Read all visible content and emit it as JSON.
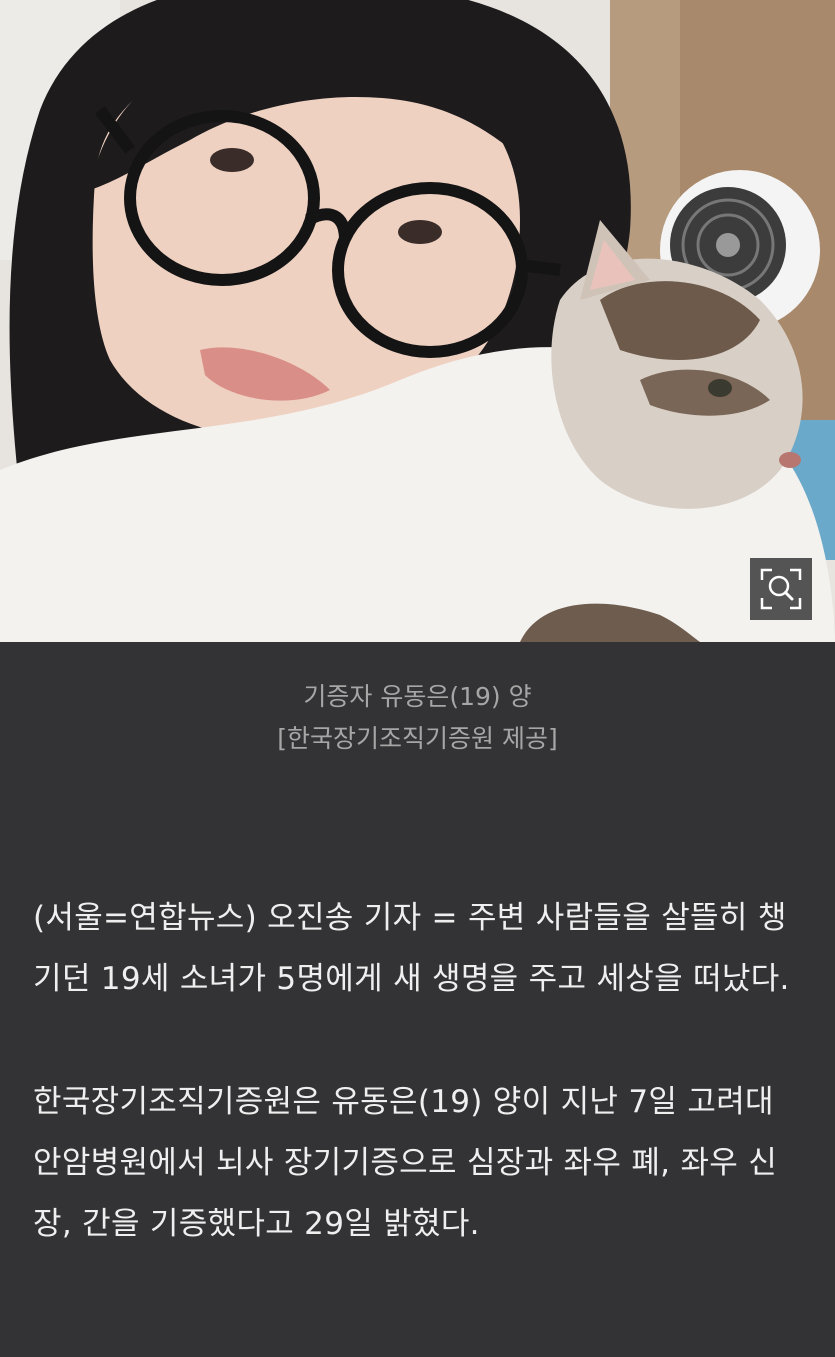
{
  "photo": {
    "zoom_icon": "magnifier-zoom-icon"
  },
  "caption": {
    "line1": "기증자 유동은(19) 양",
    "line2": "[한국장기조직기증원 제공]"
  },
  "article": {
    "p1": "(서울=연합뉴스) 오진송 기자 = 주변 사람들을 살뜰히 챙기던 19세 소녀가 5명에게 새 생명을 주고 세상을 떠났다.",
    "p2": "한국장기조직기증원은 유동은(19) 양이 지난 7일 고려대 안암병원에서 뇌사 장기기증으로 심장과 좌우 폐, 좌우 신장, 간을 기증했다고 29일 밝혔다."
  },
  "colors": {
    "background": "#333335",
    "caption_text": "#a6a6a6",
    "body_text": "#efefef"
  }
}
